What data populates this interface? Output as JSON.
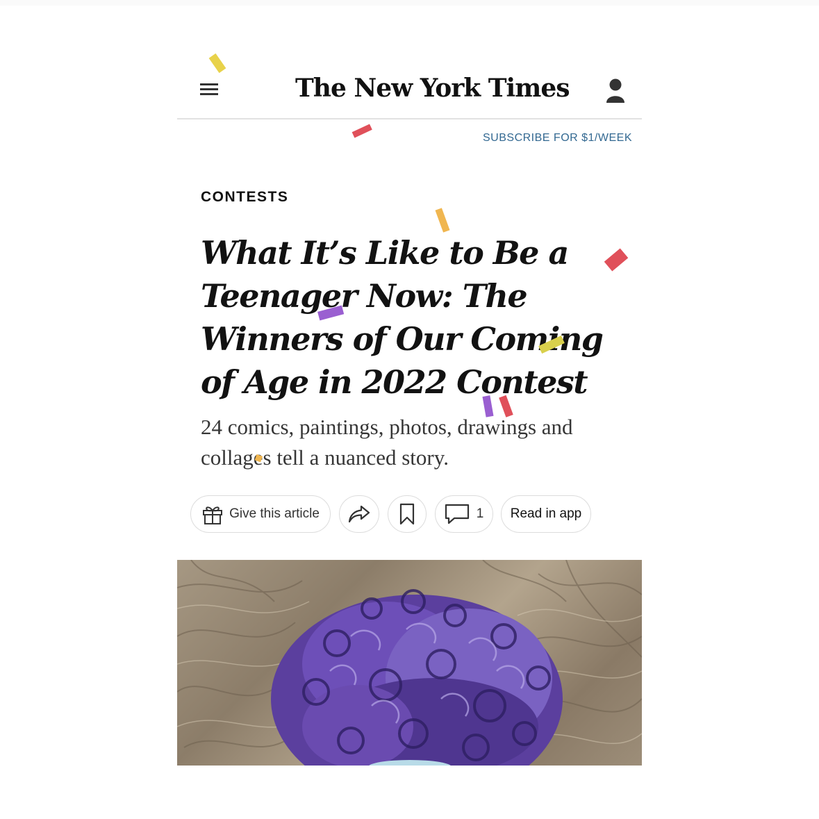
{
  "masthead": {
    "logo_text": "The New York Times",
    "menu_icon": "hamburger-menu-icon",
    "account_icon": "user-account-icon"
  },
  "subscribe": {
    "label": "SUBSCRIBE FOR $1/WEEK",
    "color": "#326891"
  },
  "article": {
    "kicker": "CONTESTS",
    "headline": "What It’s Like to Be a Teenager Now: The Winners of Our Coming of Age in 2022 Contest",
    "summary": "24 comics, paintings, photos, drawings and collages tell a nuanced story."
  },
  "actions": {
    "gift_label": "Give this article",
    "gift_icon": "gift-icon",
    "share_icon": "share-arrow-icon",
    "bookmark_icon": "bookmark-icon",
    "comment_icon": "comment-icon",
    "comment_count": "1",
    "read_in_app_label": "Read in app"
  },
  "hero_image": {
    "description_icon": "colored-pencil-drawing-purple-curly-hair-on-wood-floor"
  },
  "confetti_colors": [
    "#e8d24a",
    "#e0505a",
    "#f0b650",
    "#9a5fd1",
    "#c8c34a"
  ]
}
